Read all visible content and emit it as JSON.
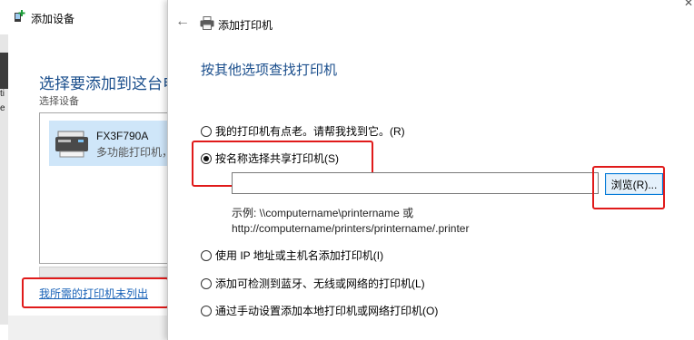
{
  "back_window": {
    "title": "添加设备",
    "heading": "选择要添加到这台电",
    "subheading": "选择设备",
    "device": {
      "name": "FX3F790A",
      "type": "多功能打印机，显"
    },
    "left_fragments": [
      "ti",
      "e"
    ],
    "missing_link": "我所需的打印机未列出"
  },
  "front_window": {
    "title": "添加打印机",
    "heading": "按其他选项查找打印机",
    "options": [
      {
        "label": "我的打印机有点老。请帮我找到它。(R)",
        "checked": false
      },
      {
        "label": "按名称选择共享打印机(S)",
        "checked": true
      },
      {
        "label": "使用 IP 地址或主机名添加打印机(I)",
        "checked": false
      },
      {
        "label": "添加可检测到蓝牙、无线或网络的打印机(L)",
        "checked": false
      },
      {
        "label": "通过手动设置添加本地打印机或网络打印机(O)",
        "checked": false
      }
    ],
    "share_name_value": "",
    "browse_label": "浏览(R)...",
    "example_line1": "示例: \\\\computername\\printername 或",
    "example_line2": "http://computername/printers/printername/.printer"
  },
  "colors": {
    "heading_blue": "#1a4e8c",
    "link_blue": "#1a63b8",
    "highlight_red": "#e01a1a",
    "selection_bg": "#cfe6f9",
    "button_border": "#0078d7"
  },
  "icons": [
    "add-device-icon",
    "printer-icon",
    "multifunction-printer-icon",
    "back-arrow-icon"
  ]
}
